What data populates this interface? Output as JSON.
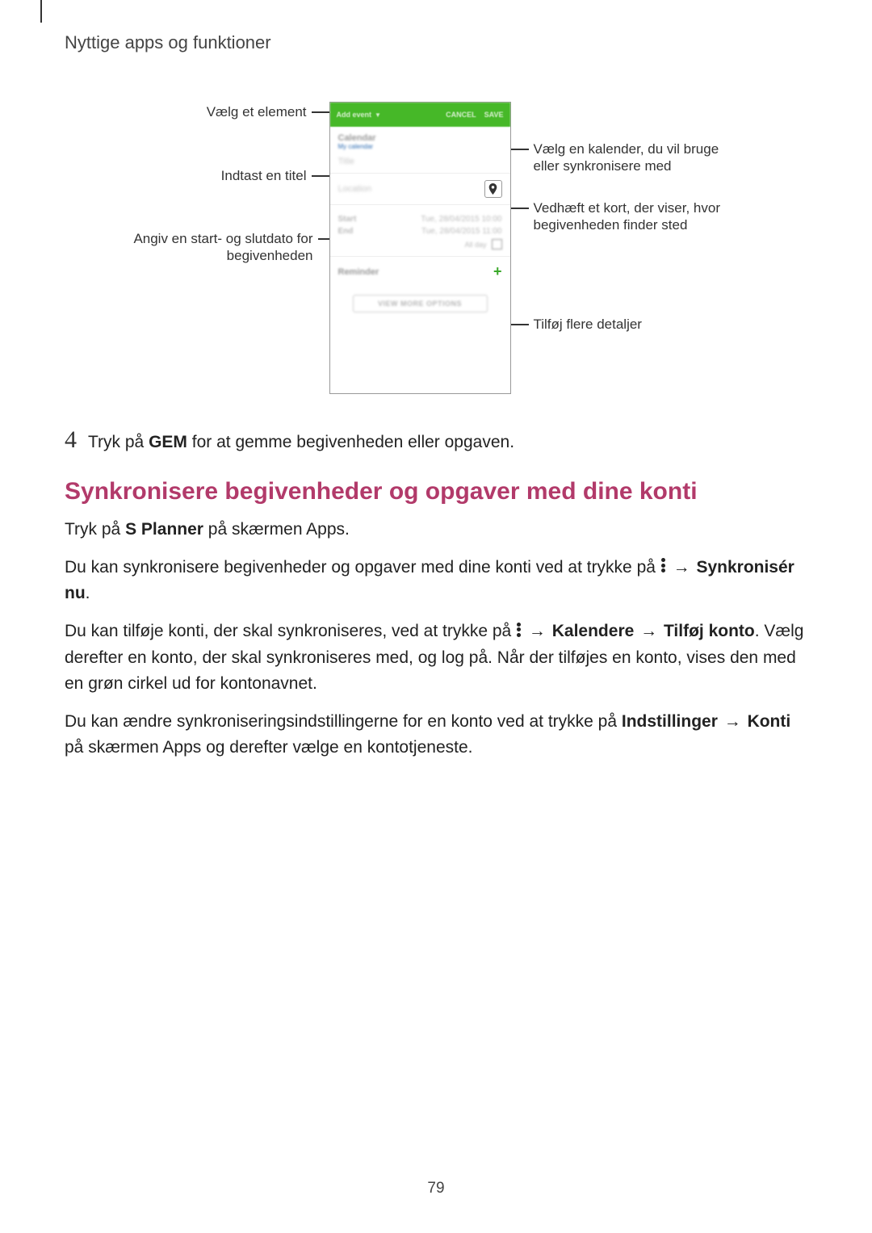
{
  "header": {
    "title": "Nyttige apps og funktioner"
  },
  "callouts": {
    "left1": "Vælg et element",
    "left2": "Indtast en titel",
    "left3": "Angiv en start- og slutdato for begivenheden",
    "right1": "Vælg en kalender, du vil bruge eller synkronisere med",
    "right2": "Vedhæft et kort, der viser, hvor begivenheden finder sted",
    "right3": "Tilføj flere detaljer"
  },
  "phone": {
    "add_event": "Add event",
    "cancel": "CANCEL",
    "save": "SAVE",
    "calendar": "Calendar",
    "my_calendar": "My calendar",
    "title": "Title",
    "location": "Location",
    "start": "Start",
    "end": "End",
    "start_dt": "Tue, 28/04/2015   10:00",
    "end_dt": "Tue, 28/04/2015   11:00",
    "all_day": "All day",
    "reminder": "Reminder",
    "view_more": "VIEW MORE OPTIONS"
  },
  "step4": {
    "num": "4",
    "pre": "Tryk på ",
    "bold": "GEM",
    "post": " for at gemme begivenheden eller opgaven."
  },
  "section_heading": "Synkronisere begivenheder og opgaver med dine konti",
  "para1": {
    "pre": "Tryk på ",
    "bold": "S Planner",
    "post": " på skærmen Apps."
  },
  "para2": {
    "pre": "Du kan synkronisere begivenheder og opgaver med dine konti ved at trykke på ",
    "arrow": " → ",
    "bold": "Synkronisér nu",
    "post": "."
  },
  "para3": {
    "pre": "Du kan tilføje konti, der skal synkroniseres, ved at trykke på ",
    "arrow": " → ",
    "bold1": "Kalendere",
    "arrow2": " → ",
    "bold2": "Tilføj konto",
    "post": ". Vælg derefter en konto, der skal synkroniseres med, og log på. Når der tilføjes en konto, vises den med en grøn cirkel ud for kontonavnet."
  },
  "para4": {
    "pre": "Du kan ændre synkroniseringsindstillingerne for en konto ved at trykke på ",
    "bold1": "Indstillinger",
    "arrow": " → ",
    "bold2": "Konti",
    "post": " på skærmen Apps og derefter vælge en kontotjeneste."
  },
  "page_number": "79"
}
